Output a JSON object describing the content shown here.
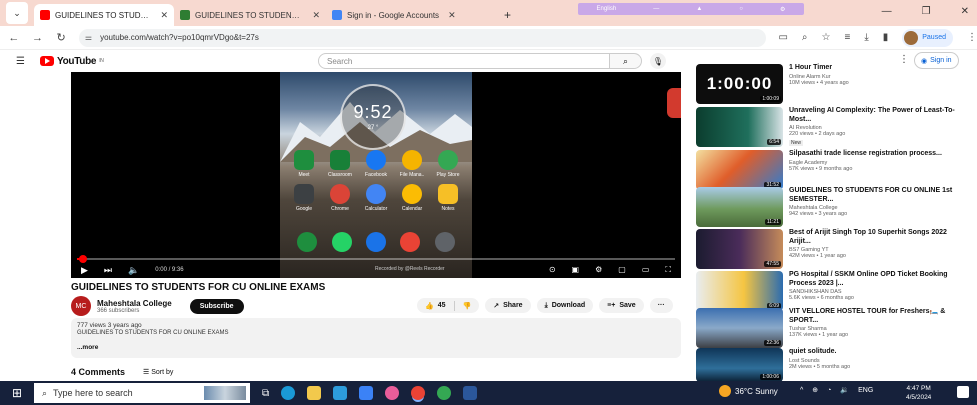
{
  "browser": {
    "tabs": [
      {
        "title": "GUIDELINES TO STUDENTS FOR",
        "active": true,
        "favicon_color": "#ff0000"
      },
      {
        "title": "GUIDELINES TO STUDENTS FOR",
        "active": false,
        "favicon_color": "#2e7d32"
      },
      {
        "title": "Sign in - Google Accounts",
        "active": false,
        "favicon_color": "#4285f4"
      }
    ],
    "close_glyph": "✕",
    "new_tab": "+",
    "mini_bar_label": "English",
    "url": "youtube.com/watch?v=po10qmrVDgo&t=27s",
    "profile_status": "Paused"
  },
  "youtube": {
    "logo": "YouTube",
    "logo_region": "IN",
    "search_placeholder": "Search",
    "sign_in": "Sign in"
  },
  "player": {
    "clock_time": "9:52",
    "weather_text": "27 °",
    "apps": [
      "Meet",
      "Classroom",
      "Facebook",
      "File Mana..",
      "Play Store",
      "Google",
      "Chrome",
      "Calculator",
      "Calendar",
      "Notes"
    ],
    "time_display": "0:00 / 9:36",
    "progress": 0.01,
    "watermark": "Recorded by @Reels Recorder"
  },
  "video": {
    "title": "GUIDELINES TO STUDENTS FOR CU ONLINE EXAMS",
    "channel": "Maheshtala College",
    "channel_initials": "MC",
    "subscribers": "366 subscribers",
    "subscribe_label": "Subscribe",
    "likes": "45",
    "share_label": "Share",
    "download_label": "Download",
    "save_label": "Save",
    "views_date": "777 views  3 years ago",
    "description": "GUIDELINES TO STUDENTS FOR CU  ONLINE EXAMS",
    "more_label": "...more",
    "comments_count": "4 Comments",
    "sort_label": "Sort by"
  },
  "recommended": [
    {
      "title": "1 Hour Timer",
      "channel": "Online Alarm Kur",
      "meta": "10M views • 4 years ago",
      "duration": "1:00:09",
      "thumb_text": "1:00:00",
      "badge": ""
    },
    {
      "title": "Unraveling AI Complexity: The Power of Least-To-Most...",
      "channel": "AI Revolution",
      "meta": "220 views • 2 days ago",
      "duration": "6:54",
      "thumb_text": "",
      "badge": "New"
    },
    {
      "title": "Silpasathi trade license registration process...",
      "channel": "Eagle Academy",
      "meta": "57K views • 9 months ago",
      "duration": "31:52",
      "thumb_text": "",
      "badge": ""
    },
    {
      "title": "GUIDELINES TO STUDENTS FOR CU ONLINE 1st SEMESTER...",
      "channel": "Maheshtala College",
      "meta": "942 views • 3 years ago",
      "duration": "11:21",
      "thumb_text": "",
      "badge": ""
    },
    {
      "title": "Best of Arijit Singh Top 10 Superhit Songs 2022 Arijit...",
      "channel": "BS7 Gaming YT",
      "meta": "42M views • 1 year ago",
      "duration": "47:55",
      "thumb_text": "",
      "badge": ""
    },
    {
      "title": "PG Hospital / SSKM Online OPD Ticket Booking Process 2023 |...",
      "channel": "SANDHIKSHAN DAS",
      "meta": "5.6K views • 6 months ago",
      "duration": "6:09",
      "thumb_text": "",
      "badge": ""
    },
    {
      "title": "VIT VELLORE HOSTEL TOUR for Freshers🛏️ & SPORT...",
      "channel": "Tushar Sharma",
      "meta": "137K views • 1 year ago",
      "duration": "22:36",
      "thumb_text": "",
      "badge": ""
    },
    {
      "title": "quiet solitude.",
      "channel": "Lost Sounds",
      "meta": "2M views • 5 months ago",
      "duration": "1:00:06",
      "thumb_text": "",
      "badge": ""
    }
  ],
  "taskbar": {
    "search_placeholder": "Type here to search",
    "weather": "36°C  Sunny",
    "language": "ENG",
    "time": "4:47 PM",
    "date": "4/5/2024"
  },
  "colors": {
    "yt_red": "#ff0000",
    "tab_strip": "#f7d9d0",
    "taskbar": "#16213b",
    "link_blue": "#065fd4"
  }
}
